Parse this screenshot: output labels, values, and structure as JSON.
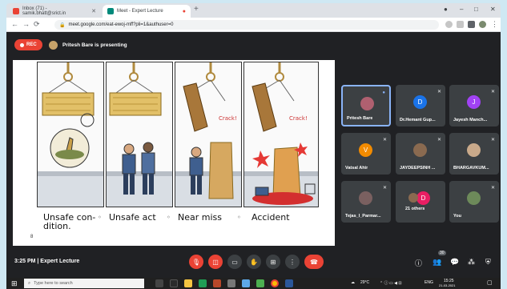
{
  "browser": {
    "tabs": [
      {
        "label": "Inbox (71) - samik.bhatt@srict.in",
        "color": "#ea4335"
      },
      {
        "label": "Meet - Expert Lecture",
        "color": "#00897b"
      }
    ],
    "new_tab": "+",
    "url": "meet.google.com/eat-ewoj-mff?pli=1&authuser=0",
    "win_min": "–",
    "win_max": "□",
    "win_close": "✕"
  },
  "meet": {
    "rec_label": "REC",
    "presenting_label": "Pritesh Bare is presenting",
    "slide": {
      "captions": [
        "Unsafe con-\ndition.",
        "Unsafe act",
        "Near miss",
        "Accident"
      ],
      "sep": "◦",
      "crack1": "Crack!",
      "crack2": "Crack!",
      "page": "8"
    },
    "participants": [
      {
        "name": "Pritesh Bare",
        "initial": "",
        "color": "#b06070"
      },
      {
        "name": "Dr.Hemant Gup...",
        "initial": "D",
        "color": "#1a73e8"
      },
      {
        "name": "Jayesh Manch...",
        "initial": "J",
        "color": "#a142f4"
      },
      {
        "name": "Vatsal Ahir",
        "initial": "V",
        "color": "#f28b00"
      },
      {
        "name": "JAYDEEPSINH ...",
        "initial": "",
        "color": "#8a6a50"
      },
      {
        "name": "BHARGAVKUM...",
        "initial": "",
        "color": "#c9a98a"
      },
      {
        "name": "Tejas_I_Parmar...",
        "initial": "",
        "color": "#7a6060"
      },
      {
        "name": "21 others",
        "initial": "D",
        "color": "#e91e63"
      },
      {
        "name": "You",
        "initial": "",
        "color": "#6d8a5a"
      }
    ],
    "time_meeting": "3:25 PM  |  Expert Lecture",
    "participant_count": "30"
  },
  "taskbar": {
    "search_placeholder": "Type here to search",
    "temperature": "29°C",
    "lang": "ENG",
    "clock": "15:25",
    "date": "21-03-2021"
  }
}
